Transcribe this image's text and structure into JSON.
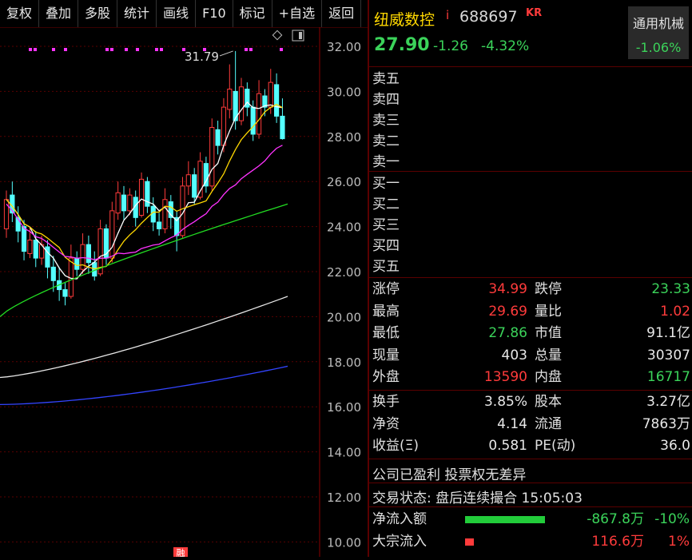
{
  "toolbar": [
    "复权",
    "叠加",
    "多股",
    "统计",
    "画线",
    "F10",
    "标记",
    "+自选",
    "返回"
  ],
  "chart": {
    "y_ticks": [
      "32.00",
      "30.00",
      "28.00",
      "26.00",
      "24.00",
      "22.00",
      "20.00",
      "18.00",
      "16.00",
      "14.00",
      "12.00",
      "10.00"
    ],
    "peak_label": "31.79",
    "badge": "融"
  },
  "chart_data": {
    "type": "candlestick",
    "y_range": [
      10,
      32.5
    ],
    "high_annotation": 31.79,
    "candles": [
      [
        23.9,
        25.2,
        23.5,
        25.6
      ],
      [
        25.4,
        24.6,
        24.2,
        26.0
      ],
      [
        24.4,
        23.8,
        23.3,
        24.9
      ],
      [
        24.0,
        22.9,
        22.5,
        24.3
      ],
      [
        22.8,
        23.4,
        22.6,
        24.0
      ],
      [
        23.4,
        22.6,
        22.2,
        23.8
      ],
      [
        22.6,
        23.2,
        22.3,
        23.6
      ],
      [
        23.1,
        22.2,
        21.7,
        23.4
      ],
      [
        22.2,
        21.6,
        21.1,
        22.7
      ],
      [
        21.6,
        21.2,
        20.7,
        22.2
      ],
      [
        21.2,
        20.9,
        20.5,
        21.5
      ],
      [
        20.9,
        22.6,
        20.8,
        23.2
      ],
      [
        22.6,
        22.1,
        21.8,
        22.9
      ],
      [
        22.1,
        23.2,
        21.9,
        23.7
      ],
      [
        23.2,
        22.4,
        21.9,
        23.6
      ],
      [
        22.4,
        21.8,
        21.6,
        22.9
      ],
      [
        21.9,
        23.9,
        21.8,
        24.3
      ],
      [
        23.9,
        22.6,
        22.3,
        24.1
      ],
      [
        22.6,
        24.7,
        22.4,
        25.1
      ],
      [
        24.6,
        25.5,
        24.3,
        26.0
      ],
      [
        25.4,
        24.7,
        24.3,
        25.8
      ],
      [
        24.7,
        25.4,
        24.5,
        25.7
      ],
      [
        25.3,
        24.4,
        24.0,
        25.6
      ],
      [
        24.5,
        26.1,
        24.4,
        26.4
      ],
      [
        26.0,
        24.9,
        24.6,
        26.2
      ],
      [
        24.9,
        24.2,
        23.8,
        25.3
      ],
      [
        24.2,
        23.9,
        23.6,
        24.6
      ],
      [
        23.9,
        25.2,
        23.7,
        25.7
      ],
      [
        25.1,
        24.4,
        23.9,
        25.4
      ],
      [
        24.4,
        23.6,
        22.9,
        24.7
      ],
      [
        23.6,
        25.8,
        23.5,
        26.2
      ],
      [
        25.8,
        26.3,
        25.4,
        26.9
      ],
      [
        26.3,
        25.3,
        25.0,
        26.6
      ],
      [
        25.3,
        26.9,
        25.2,
        27.3
      ],
      [
        26.8,
        25.8,
        25.5,
        27.1
      ],
      [
        25.8,
        28.4,
        25.6,
        28.8
      ],
      [
        28.3,
        27.6,
        27.2,
        28.7
      ],
      [
        27.6,
        29.3,
        27.3,
        29.7
      ],
      [
        29.2,
        30.1,
        28.8,
        31.2
      ],
      [
        30.0,
        28.7,
        28.3,
        31.79
      ],
      [
        28.7,
        30.2,
        28.5,
        30.6
      ],
      [
        30.1,
        29.3,
        28.9,
        30.4
      ],
      [
        29.3,
        28.1,
        27.8,
        29.6
      ],
      [
        28.1,
        29.9,
        27.9,
        30.5
      ],
      [
        29.8,
        29.3,
        28.9,
        30.1
      ],
      [
        29.3,
        30.4,
        29.0,
        31.0
      ],
      [
        30.3,
        28.9,
        28.6,
        30.8
      ],
      [
        28.9,
        27.9,
        27.86,
        29.69
      ]
    ]
  },
  "stock": {
    "name": "纽威数控",
    "flag": "i",
    "code": "688697",
    "tag": "KR",
    "price": "27.90",
    "change": "-1.26",
    "change_pct": "-4.32%",
    "sector_name": "通用机械",
    "sector_change": "-1.06%"
  },
  "orderbook": {
    "sell": [
      "卖五",
      "卖四",
      "卖三",
      "卖二",
      "卖一"
    ],
    "buy": [
      "买一",
      "买二",
      "买三",
      "买四",
      "买五"
    ]
  },
  "quotes1": [
    {
      "l1": "涨停",
      "v1": "34.99",
      "c1": "red",
      "l2": "跌停",
      "v2": "23.33",
      "c2": "green"
    },
    {
      "l1": "最高",
      "v1": "29.69",
      "c1": "red",
      "l2": "量比",
      "v2": "1.02",
      "c2": "red"
    },
    {
      "l1": "最低",
      "v1": "27.86",
      "c1": "green",
      "l2": "市值",
      "v2": "91.1亿",
      "c2": "white"
    },
    {
      "l1": "现量",
      "v1": "403",
      "c1": "white",
      "l2": "总量",
      "v2": "30307",
      "c2": "white"
    },
    {
      "l1": "外盘",
      "v1": "13590",
      "c1": "red",
      "l2": "内盘",
      "v2": "16717",
      "c2": "green"
    }
  ],
  "quotes2": [
    {
      "l1": "换手",
      "v1": "3.85%",
      "c1": "white",
      "l2": "股本",
      "v2": "3.27亿",
      "c2": "white"
    },
    {
      "l1": "净资",
      "v1": "4.14",
      "c1": "white",
      "l2": "流通",
      "v2": "7863万",
      "c2": "white"
    },
    {
      "l1": "收益(Ξ)",
      "v1": "0.581",
      "c1": "white",
      "l2": "PE(动)",
      "v2": "36.0",
      "c2": "white"
    }
  ],
  "notes": {
    "profit": "公司已盈利 投票权无差异",
    "status": "交易状态: 盘后连续撮合 15:05:03"
  },
  "flows": [
    {
      "label": "净流入额",
      "value": "-867.8万",
      "pct": "-10%",
      "color": "#22cc3a",
      "bar": 0.95,
      "cls": "green"
    },
    {
      "label": "大宗流入",
      "value": "116.6万",
      "pct": "1%",
      "color": "#ff3b3b",
      "bar": 0.1,
      "cls": "red"
    }
  ]
}
